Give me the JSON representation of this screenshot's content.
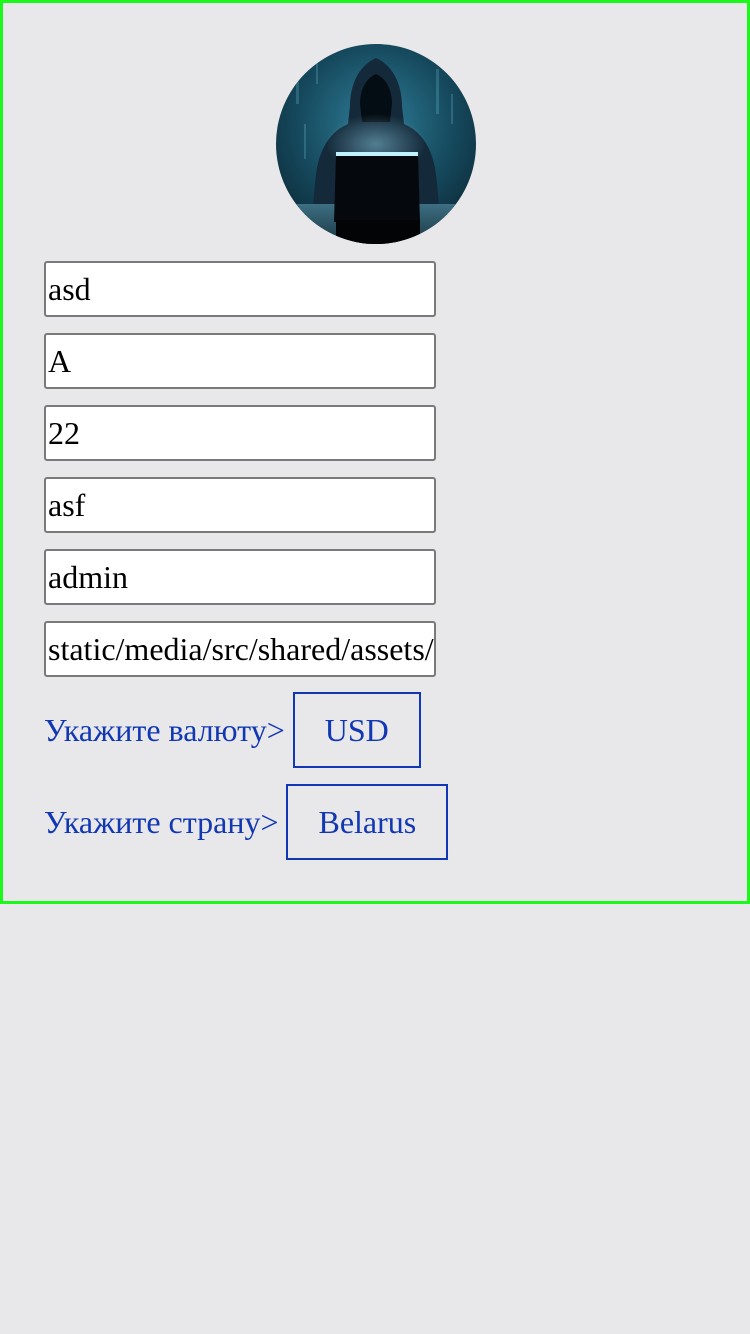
{
  "profile": {
    "avatar_icon": "hooded-hacker-avatar",
    "fields": [
      {
        "name": "first-name-field",
        "value": "asd"
      },
      {
        "name": "last-name-field",
        "value": "A"
      },
      {
        "name": "age-field",
        "value": "22"
      },
      {
        "name": "nickname-field",
        "value": "asf"
      },
      {
        "name": "role-field",
        "value": "admin"
      },
      {
        "name": "avatar-path-field",
        "value": "static/media/src/shared/assets/"
      }
    ]
  },
  "currency": {
    "label": "Укажите валюту>",
    "value": "USD"
  },
  "country": {
    "label": "Укажите страну>",
    "value": "Belarus"
  },
  "colors": {
    "frame_border": "#1cf71c",
    "link_blue": "#1237b3",
    "background": "#e8e8ea"
  }
}
